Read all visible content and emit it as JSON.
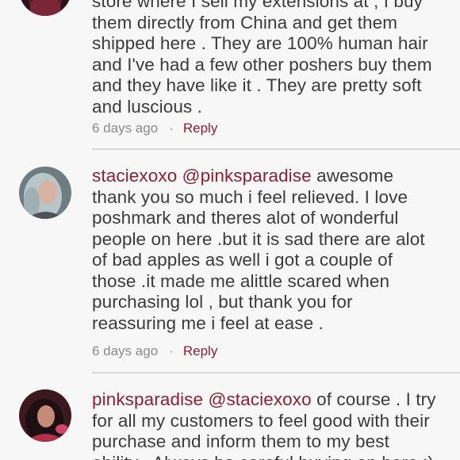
{
  "comments": [
    {
      "lines": [
        "store where I sell my extensions at , I buy",
        "them directly from China and get them",
        "shipped here . They are 100% human hair",
        "and I've had a few other poshers buy them",
        "and they have like it . They are pretty soft",
        "and luscious ."
      ],
      "time": "6 days ago",
      "reply": "Reply"
    },
    {
      "username": "staciexoxo",
      "mention": "@pinksparadise",
      "first_line_rest": " awesome",
      "lines": [
        "thank you so much i feel relieved. I love",
        "poshmark and theres alot of wonderful",
        "people on here .but it is sad there are alot",
        "of bad apples as well i got a couple of",
        "those .it made me alittle scared when",
        "purchasing lol , but thank you for",
        "reassuring me i feel at ease ."
      ],
      "time": "6 days ago",
      "reply": "Reply"
    },
    {
      "username": "pinksparadise",
      "mention": "@staciexoxo",
      "first_line_rest": " of course . I try",
      "lines": [
        "for all my customers to feel good with their",
        "purchase and inform them to my best",
        "ability . Always be careful buying on here :)"
      ]
    }
  ],
  "colors": {
    "accent": "#8b2136",
    "text": "#3b3b3b",
    "meta": "#8a8a8a",
    "background": "#f7f7f7",
    "divider": "#d9d9d9"
  }
}
